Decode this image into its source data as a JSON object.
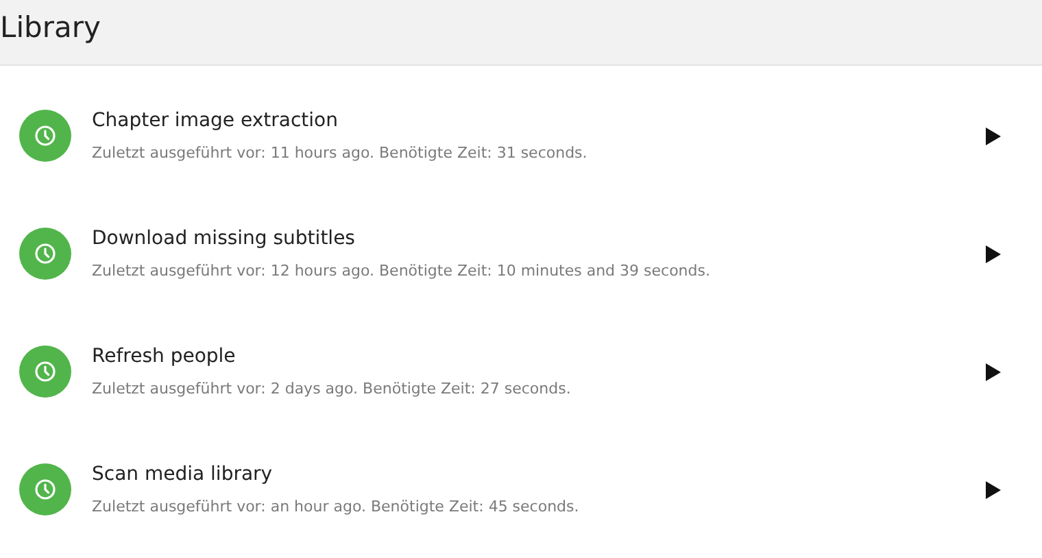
{
  "header": {
    "title": "Library"
  },
  "tasks": [
    {
      "name": "Chapter image extraction",
      "status": "Zuletzt ausgeführt vor: 11 hours ago. Benötigte Zeit: 31 seconds."
    },
    {
      "name": "Download missing subtitles",
      "status": "Zuletzt ausgeführt vor: 12 hours ago. Benötigte Zeit: 10 minutes and 39 seconds."
    },
    {
      "name": "Refresh people",
      "status": "Zuletzt ausgeführt vor: 2 days ago. Benötigte Zeit: 27 seconds."
    },
    {
      "name": "Scan media library",
      "status": "Zuletzt ausgeführt vor: an hour ago. Benötigte Zeit: 45 seconds."
    }
  ]
}
